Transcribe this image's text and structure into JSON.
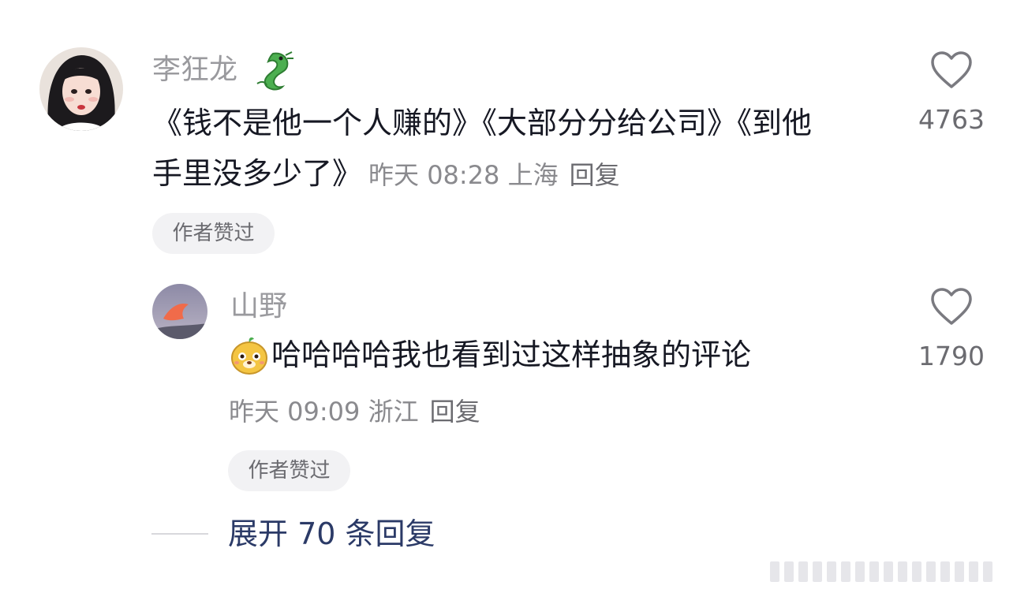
{
  "comment": {
    "username": "李狂龙",
    "text_line1": "《钱不是他一个人赚的》《大部分分给公司》《到他",
    "text_line2": "手里没多少了》",
    "meta": "昨天 08:28 上海",
    "reply_label": "回复",
    "liked_badge": "作者赞过",
    "like_count": "4763",
    "icons": {
      "name_badge": "dragon-emoji-icon",
      "like": "heart-outline-icon"
    }
  },
  "reply": {
    "username": "山野",
    "text": "哈哈哈哈我也看到过这样抽象的评论",
    "meta": "昨天 09:09 浙江",
    "reply_label": "回复",
    "liked_badge": "作者赞过",
    "like_count": "1790",
    "icons": {
      "leading": "mascot-sticker-icon",
      "like": "heart-outline-icon"
    }
  },
  "expand": {
    "label": "展开 70 条回复"
  },
  "colors": {
    "text": "#161823",
    "muted": "#9a9a9e",
    "link": "#2b3a67",
    "badge_bg": "#f2f2f4"
  }
}
